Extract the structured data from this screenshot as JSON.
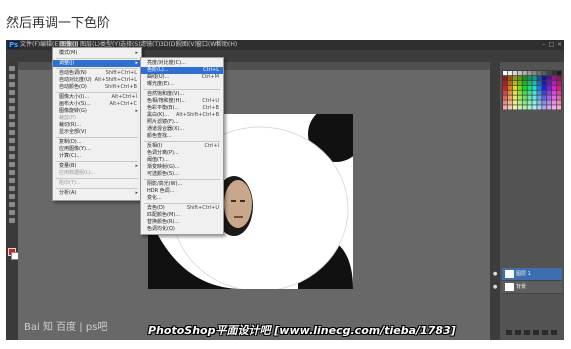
{
  "heading": "然后再调一下色阶",
  "app_logo": "Ps",
  "menubar": {
    "items": [
      "文件(F)",
      "编辑(E)",
      "图像(I)",
      "图层(L)",
      "类型(Y)",
      "选择(S)",
      "滤镜(T)",
      "3D(D)",
      "视图(V)",
      "窗口(W)",
      "帮助(H)"
    ]
  },
  "image_menu": {
    "items": [
      {
        "label": "模式(M)",
        "shortcut": "",
        "submenu": true
      },
      {
        "label": "调整(J)",
        "shortcut": "",
        "submenu": true,
        "highlighted": true
      },
      {
        "label": "自动色调(N)",
        "shortcut": "Shift+Ctrl+L"
      },
      {
        "label": "自动对比度(U)",
        "shortcut": "Alt+Shift+Ctrl+L"
      },
      {
        "label": "自动颜色(O)",
        "shortcut": "Shift+Ctrl+B"
      },
      {
        "label": "图像大小(I)...",
        "shortcut": "Alt+Ctrl+I"
      },
      {
        "label": "画布大小(S)...",
        "shortcut": "Alt+Ctrl+C"
      },
      {
        "label": "图像旋转(G)",
        "shortcut": "",
        "submenu": true
      },
      {
        "label": "裁剪(P)",
        "shortcut": "",
        "disabled": true
      },
      {
        "label": "裁切(R)...",
        "shortcut": ""
      },
      {
        "label": "显示全部(V)",
        "shortcut": ""
      },
      {
        "label": "复制(D)...",
        "shortcut": ""
      },
      {
        "label": "应用图像(Y)...",
        "shortcut": ""
      },
      {
        "label": "计算(C)...",
        "shortcut": ""
      },
      {
        "label": "变量(B)",
        "shortcut": "",
        "submenu": true
      },
      {
        "label": "应用数据组(L)...",
        "shortcut": "",
        "disabled": true
      },
      {
        "label": "陷印(T)...",
        "shortcut": "",
        "disabled": true
      },
      {
        "label": "分析(A)",
        "shortcut": "",
        "submenu": true
      }
    ]
  },
  "adjust_menu": {
    "items": [
      {
        "label": "亮度/对比度(C)...",
        "shortcut": ""
      },
      {
        "label": "色阶(L)...",
        "shortcut": "Ctrl+L",
        "highlighted": true
      },
      {
        "label": "曲线(U)...",
        "shortcut": "Ctrl+M"
      },
      {
        "label": "曝光度(E)...",
        "shortcut": ""
      },
      {
        "label": "自然饱和度(V)...",
        "shortcut": ""
      },
      {
        "label": "色相/饱和度(H)...",
        "shortcut": "Ctrl+U"
      },
      {
        "label": "色彩平衡(B)...",
        "shortcut": "Ctrl+B"
      },
      {
        "label": "黑白(K)...",
        "shortcut": "Alt+Shift+Ctrl+B"
      },
      {
        "label": "照片滤镜(F)...",
        "shortcut": ""
      },
      {
        "label": "通道混合器(X)...",
        "shortcut": ""
      },
      {
        "label": "颜色查找...",
        "shortcut": ""
      },
      {
        "label": "反相(I)",
        "shortcut": "Ctrl+I"
      },
      {
        "label": "色调分离(P)...",
        "shortcut": ""
      },
      {
        "label": "阈值(T)...",
        "shortcut": ""
      },
      {
        "label": "渐变映射(G)...",
        "shortcut": ""
      },
      {
        "label": "可选颜色(S)...",
        "shortcut": ""
      },
      {
        "label": "阴影/高光(W)...",
        "shortcut": ""
      },
      {
        "label": "HDR 色调...",
        "shortcut": ""
      },
      {
        "label": "变化...",
        "shortcut": ""
      },
      {
        "label": "去色(D)",
        "shortcut": "Shift+Ctrl+U"
      },
      {
        "label": "匹配颜色(M)...",
        "shortcut": ""
      },
      {
        "label": "替换颜色(R)...",
        "shortcut": ""
      },
      {
        "label": "色调均化(Q)",
        "shortcut": ""
      }
    ]
  },
  "layers": [
    {
      "name": "图层 1",
      "selected": true
    },
    {
      "name": "背景",
      "selected": false
    }
  ],
  "colors": {
    "foreground": "#d91f1f",
    "background": "#ffffff",
    "highlight": "#2f6fcf"
  },
  "watermark": "Bai 知 百度 | ps吧",
  "footer": "PhotoShop平面设计吧  [www.linecg.com/tieba/1783]"
}
